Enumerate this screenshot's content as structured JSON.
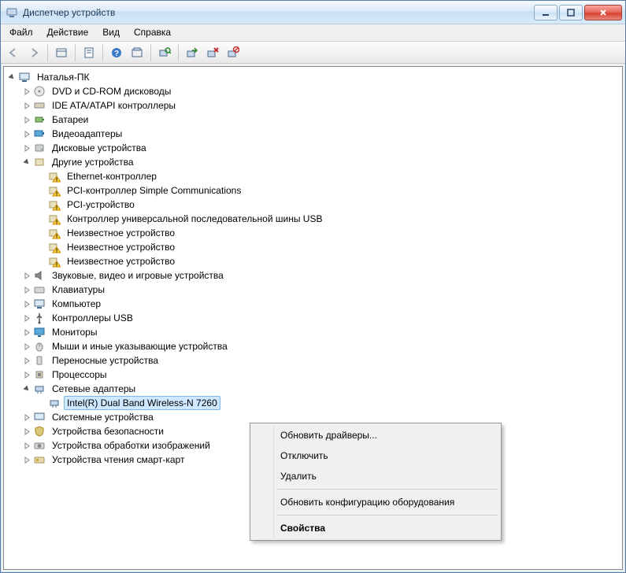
{
  "window": {
    "title": "Диспетчер устройств"
  },
  "menu": {
    "file": "Файл",
    "action": "Действие",
    "view": "Вид",
    "help": "Справка"
  },
  "tree": {
    "root": "Наталья-ПК",
    "dvd": "DVD и CD-ROM дисководы",
    "ide": "IDE ATA/ATAPI контроллеры",
    "battery": "Батареи",
    "video": "Видеоадаптеры",
    "disk": "Дисковые устройства",
    "other": "Другие устройства",
    "other_ethernet": "Ethernet-контроллер",
    "other_pci_simple": "PCI-контроллер Simple Communications",
    "other_pci": "PCI-устройство",
    "other_usb": "Контроллер универсальной последовательной шины USB",
    "other_unknown1": "Неизвестное устройство",
    "other_unknown2": "Неизвестное устройство",
    "other_unknown3": "Неизвестное устройство",
    "sound": "Звуковые, видео и игровые устройства",
    "keyboard": "Клавиатуры",
    "computer": "Компьютер",
    "usbctrl": "Контроллеры USB",
    "monitor": "Мониторы",
    "mouse": "Мыши и иные указывающие устройства",
    "portable": "Переносные устройства",
    "cpu": "Процессоры",
    "net": "Сетевые адаптеры",
    "net_intel": "Intel(R) Dual Band Wireless-N 7260",
    "system": "Системные устройства",
    "security": "Устройства безопасности",
    "imaging": "Устройства обработки изображений",
    "smartcard": "Устройства чтения смарт-карт"
  },
  "context_menu": {
    "update": "Обновить драйверы...",
    "disable": "Отключить",
    "delete": "Удалить",
    "rescan": "Обновить конфигурацию оборудования",
    "properties": "Свойства"
  }
}
